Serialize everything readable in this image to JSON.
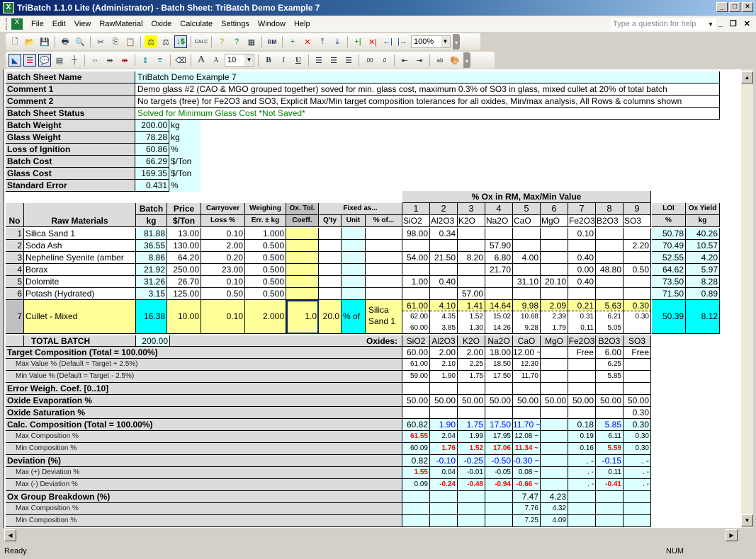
{
  "window": {
    "title": "TriBatch 1.1.0 Lite (Administrator) - Batch Sheet: TriBatch Demo Example 7",
    "buttons": [
      "_",
      "□",
      "X"
    ]
  },
  "menu": {
    "items": [
      "File",
      "Edit",
      "View",
      "RawMaterial",
      "Oxide",
      "Calculate",
      "Settings",
      "Window",
      "Help"
    ],
    "help_placeholder": "Type a question for help"
  },
  "toolbar": {
    "zoom": "100%",
    "font_size": "10",
    "bold": "B",
    "italic": "I",
    "underline": "U"
  },
  "summary": [
    {
      "label": "Batch Sheet Name",
      "value": "TriBatch Demo Example 7"
    },
    {
      "label": "Comment 1",
      "value": "Demo glass #2 (CAO & MGO grouped together) soved for min. glass cost, maximum 0.3% of SO3 in glass, mixed cullet at 20% of total batch"
    },
    {
      "label": "Comment 2",
      "value": "No targets (free) for Fe2O3 and SO3, Explicit Max/Min target composition tolerances for all oxides, Min/max analysis, All Rows & columns shown"
    },
    {
      "label": "Batch Sheet Status",
      "value": "Solved for Minimum Glass Cost *Not Saved*"
    }
  ],
  "stats": [
    {
      "label": "Batch Weight",
      "value": "200.00",
      "unit": "kg"
    },
    {
      "label": "Glass Weight",
      "value": "78.28",
      "unit": "kg"
    },
    {
      "label": "Loss of Ignition",
      "value": "60.86",
      "unit": "%"
    },
    {
      "label": "Batch Cost",
      "value": "66.29",
      "unit": "$/Ton"
    },
    {
      "label": "Glass Cost",
      "value": "169.35",
      "unit": "$/Ton"
    },
    {
      "label": "Standard Error",
      "value": "0.431",
      "unit": "%"
    }
  ],
  "headers": {
    "no": "No",
    "raw_materials": "Raw Materials",
    "batch": [
      "Batch",
      "kg"
    ],
    "price": [
      "Price",
      "$/Ton"
    ],
    "carryover": [
      "Carryover",
      "Loss %"
    ],
    "weighing": [
      "Weighing",
      "Err. ± kg"
    ],
    "oxtol": [
      "Ox. Tol.",
      "Coeff."
    ],
    "fixed": "Fixed as...",
    "fixed_sub": [
      "Q'ty",
      "Unit",
      "% of..."
    ],
    "ox_group": "% Ox in RM, Max/Min Value",
    "ox_nums": [
      "1",
      "2",
      "3",
      "4",
      "5",
      "6",
      "7",
      "8",
      "9"
    ],
    "ox_names": [
      "SiO2",
      "Al2O3",
      "K2O",
      "Na2O",
      "CaO",
      "MgO",
      "Fe2O3",
      "B2O3",
      "SO3"
    ],
    "loi": [
      "LOI",
      "%"
    ],
    "yield": [
      "Ox Yield",
      "kg"
    ]
  },
  "materials": [
    {
      "no": "1",
      "name": "Silica Sand 1",
      "batch": "81.88",
      "price": "13.00",
      "loss": "0.10",
      "err": "1.000",
      "ox": [
        "98.00",
        "0.34",
        "",
        "",
        "",
        "",
        "0.10",
        "",
        ""
      ],
      "loi": "50.78",
      "yield": "40.26"
    },
    {
      "no": "2",
      "name": "Soda Ash",
      "batch": "36.55",
      "price": "130.00",
      "loss": "2.00",
      "err": "0.500",
      "ox": [
        "",
        "",
        "",
        "57.90",
        "",
        "",
        "",
        "",
        "2.20"
      ],
      "loi": "70.49",
      "yield": "10.57"
    },
    {
      "no": "3",
      "name": "Nepheline Syenite (amber",
      "batch": "8.86",
      "price": "64.20",
      "loss": "0.20",
      "err": "0.500",
      "ox": [
        "54.00",
        "21.50",
        "8.20",
        "6.80",
        "4.00",
        "",
        "0.40",
        "",
        ""
      ],
      "loi": "52.55",
      "yield": "4.20"
    },
    {
      "no": "4",
      "name": "Borax",
      "batch": "21.92",
      "price": "250.00",
      "loss": "23.00",
      "err": "0.500",
      "ox": [
        "",
        "",
        "",
        "21.70",
        "",
        "",
        "0.00",
        "48.80",
        "0.50"
      ],
      "loi": "64.62",
      "yield": "5.97"
    },
    {
      "no": "5",
      "name": "Dolomite",
      "batch": "31.26",
      "price": "26.70",
      "loss": "0.10",
      "err": "0.500",
      "ox": [
        "1.00",
        "0.40",
        "",
        "",
        "31.10",
        "20.10",
        "0.40",
        "",
        ""
      ],
      "loi": "73.50",
      "yield": "8.28"
    },
    {
      "no": "6",
      "name": "Potash (Hydrated)",
      "batch": "3.15",
      "price": "125.00",
      "loss": "0.50",
      "err": "0.500",
      "ox": [
        "",
        "",
        "57.00",
        "",
        "",
        "",
        "",
        "",
        ""
      ],
      "loi": "71.50",
      "yield": "0.89"
    }
  ],
  "cullet": {
    "no": "7",
    "name": "Cullet - Mixed",
    "batch": "16.38",
    "price": "10.00",
    "loss": "0.10",
    "err": "2.000",
    "coeff": "1.0",
    "qty": "20.0",
    "unit": "% of",
    "of": "Silica Sand 1",
    "ox": [
      "61.00",
      "4.10",
      "1.41",
      "14.64",
      "9.98",
      "2.09",
      "0.21",
      "5.63",
      "0.30"
    ],
    "ox_max": [
      "62.00",
      "4.35",
      "1.52",
      "15.02",
      "10.68",
      "2.39",
      "0.31",
      "6.21",
      "0.30"
    ],
    "ox_min": [
      "60.00",
      "3.85",
      "1.30",
      "14.26",
      "9.28",
      "1.79",
      "0.11",
      "5.05",
      ""
    ],
    "loi": "50.39",
    "yield": "8.12"
  },
  "total": {
    "label": "TOTAL BATCH",
    "value": "200.00",
    "oxides_label": "Oxides:"
  },
  "analysis": [
    {
      "label": "Target Composition (Total = 100.00%)",
      "kind": "main",
      "vals": [
        "60.00",
        "2.00",
        "2.00",
        "18.00",
        "12.00 ~",
        "",
        "Free",
        "6.00",
        "Free"
      ]
    },
    {
      "label": "Max Value % (Default = Target + 2.5%)",
      "kind": "sub",
      "vals": [
        "61.00",
        "2.10",
        "2.25",
        "18.50",
        "12.30",
        "",
        "",
        "6.25",
        ""
      ]
    },
    {
      "label": "Min Value % (Default = Target - 2.5%)",
      "kind": "sub",
      "vals": [
        "59.00",
        "1.90",
        "1.75",
        "17.50",
        "11.70",
        "",
        "",
        "5.85",
        ""
      ]
    },
    {
      "label": "Error Weigh. Coef. [0..10]",
      "kind": "main",
      "vals": [
        "",
        "",
        "",
        "",
        "",
        "",
        "",
        "",
        ""
      ]
    },
    {
      "label": "Oxide Evaporation %",
      "kind": "main",
      "vals": [
        "50.00",
        "50.00",
        "50.00",
        "50.00",
        "50.00",
        "50.00",
        "50.00",
        "50.00",
        "50.00"
      ]
    },
    {
      "label": "Oxide Saturation %",
      "kind": "main",
      "vals": [
        "",
        "",
        "",
        "",
        "",
        "",
        "",
        "",
        "0.30"
      ]
    },
    {
      "label": "Calc. Composition (Total = 100.00%)",
      "kind": "main",
      "cyan": true,
      "vals": [
        "60.82",
        "1.90",
        "1.75",
        "17.50",
        "11.70 ~",
        "",
        "0.18",
        "5.85",
        "0.30"
      ],
      "colors": [
        "",
        "b",
        "b",
        "b",
        "b",
        "",
        "",
        "b",
        ""
      ]
    },
    {
      "label": "Max Composition %",
      "kind": "sub",
      "cyan": true,
      "vals": [
        "61.55",
        "2.04",
        "1.99",
        "17.95",
        "12.08 ~",
        "",
        "0.19",
        "6.11",
        "0.30"
      ],
      "colors": [
        "r",
        "",
        "",
        "",
        "",
        "",
        "",
        "",
        ""
      ]
    },
    {
      "label": "Min Composition %",
      "kind": "sub",
      "cyan": true,
      "vals": [
        "60.09",
        "1.76",
        "1.52",
        "17.06",
        "11.34 ~",
        "",
        "0.16",
        "5.59",
        "0.30"
      ],
      "colors": [
        "",
        "r",
        "r",
        "r",
        "r",
        "",
        "",
        "r",
        ""
      ]
    },
    {
      "label": "Deviation (%)",
      "kind": "main",
      "cyan": true,
      "vals": [
        "0.82",
        "-0.10",
        "-0.25",
        "-0.50",
        "-0.30 ~",
        "",
        ".    -",
        "-0.15",
        ".    -"
      ],
      "colors": [
        "",
        "b",
        "b",
        "b",
        "b",
        "",
        "",
        "b",
        ""
      ]
    },
    {
      "label": "Max (+) Deviation %",
      "kind": "sub",
      "cyan": true,
      "vals": [
        "1.55",
        "0.04",
        "-0.01",
        "-0.05",
        "0.08 ~",
        "",
        ".    -",
        "0.11",
        ".    -"
      ],
      "colors": [
        "r",
        "",
        "",
        "",
        "",
        "",
        "",
        "",
        ""
      ]
    },
    {
      "label": "Max (-) Deviation %",
      "kind": "sub",
      "cyan": true,
      "vals": [
        "0.09",
        "-0.24",
        "-0.48",
        "-0.94",
        "-0.66 ~",
        "",
        ".    -",
        "-0.41",
        ".    -"
      ],
      "colors": [
        "",
        "r",
        "r",
        "r",
        "r",
        "",
        "",
        "r",
        ""
      ]
    },
    {
      "label": "Ox Group Breakdown (%)",
      "kind": "main",
      "cyan": true,
      "vals": [
        "",
        "",
        "",
        "",
        "7.47",
        "4.23",
        "",
        "",
        ""
      ]
    },
    {
      "label": "Max Composition %",
      "kind": "sub",
      "cyan": true,
      "vals": [
        "",
        "",
        "",
        "",
        "7.76",
        "4.32",
        "",
        "",
        ""
      ]
    },
    {
      "label": "Min Composition %",
      "kind": "sub",
      "cyan": true,
      "vals": [
        "",
        "",
        "",
        "",
        "7.25",
        "4.09",
        "",
        "",
        ""
      ]
    }
  ],
  "status": {
    "text": "Ready",
    "num": "NUM"
  }
}
